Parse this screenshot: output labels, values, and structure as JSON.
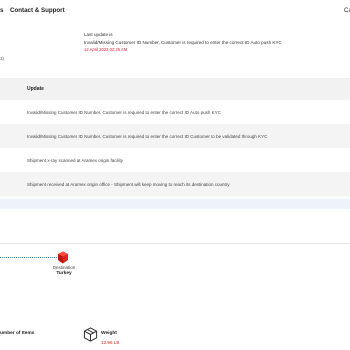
{
  "nav": {
    "fragment": "s",
    "contact_label": "Contact & Support",
    "cut_label": "Ca"
  },
  "last_update": {
    "title": "Last update is",
    "message": "Invalid/Missing Customer ID Number, Customer is required to enter the correct ID Auto push KYC",
    "timestamp": "12 April 2023 02:25 AM"
  },
  "left_fragment": "1)",
  "table": {
    "header": "Update",
    "rows": [
      "Invalid/Missing Customer ID Number, Customer is required to enter the correct ID Auto push KYC",
      "Invalid/Missing Customer ID Number, Customer is required to enter the correct ID Customer to be validated through KYC",
      "Shipment x-ray scanned at Aramex origin facility",
      "Shipment received at Aramex origin office - Shipment will keep moving to reach its destination country"
    ]
  },
  "route": {
    "destination_label": "Destination",
    "destination_value": "Turkey"
  },
  "details": {
    "items_label": "umber of Items",
    "weight_label": "Weight",
    "weight_value": "12.96 LB"
  },
  "colors": {
    "accent": "#e2231a",
    "route_line": "#1e8fd6",
    "header_bg": "#f2f2f2"
  },
  "icons": {
    "destination": "location-pin-icon",
    "package": "package-box-icon"
  }
}
